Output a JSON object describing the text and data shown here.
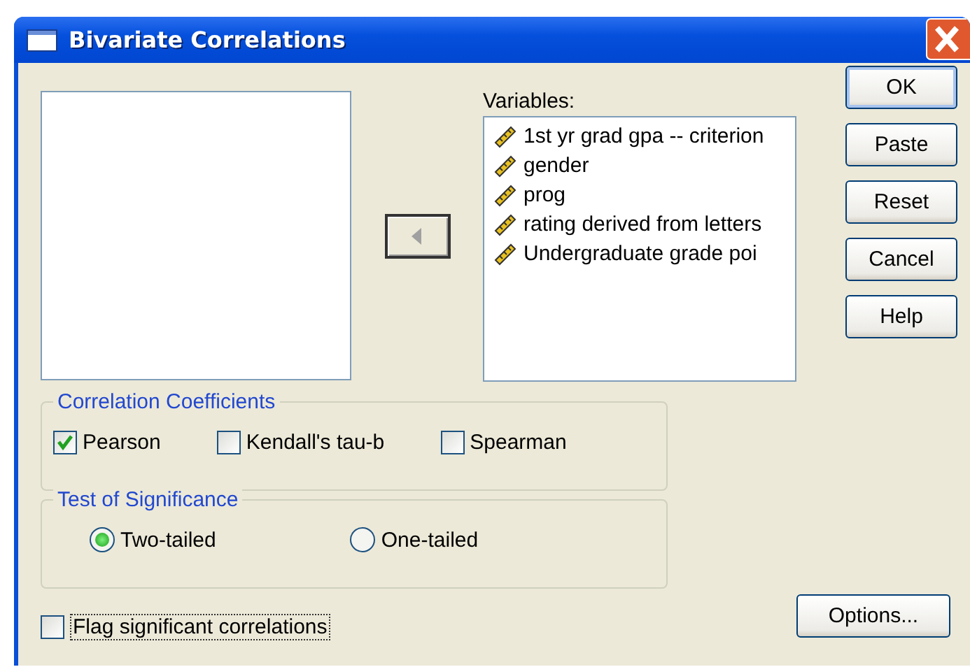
{
  "window": {
    "title": "Bivariate Correlations"
  },
  "move_button": {
    "disabled": true
  },
  "variables": {
    "label": "Variables:",
    "items": [
      {
        "name": "1st yr grad gpa -- criterion"
      },
      {
        "name": "gender"
      },
      {
        "name": "prog"
      },
      {
        "name": "rating derived from letters"
      },
      {
        "name": "Undergraduate grade poi"
      }
    ]
  },
  "buttons": [
    {
      "label": "OK",
      "default": true
    },
    {
      "label": "Paste",
      "default": false
    },
    {
      "label": "Reset",
      "default": false
    },
    {
      "label": "Cancel",
      "default": false
    },
    {
      "label": "Help",
      "default": false
    }
  ],
  "correlation_coefficients": {
    "title": "Correlation Coefficients",
    "options": [
      {
        "label": "Pearson",
        "checked": true
      },
      {
        "label": "Kendall's tau-b",
        "checked": false
      },
      {
        "label": "Spearman",
        "checked": false
      }
    ]
  },
  "test_of_significance": {
    "title": "Test of Significance",
    "options": [
      {
        "label": "Two-tailed",
        "selected": true
      },
      {
        "label": "One-tailed",
        "selected": false
      }
    ]
  },
  "flag": {
    "label": "Flag significant correlations",
    "checked": false,
    "focused": true
  },
  "options_button": {
    "label": "Options..."
  }
}
